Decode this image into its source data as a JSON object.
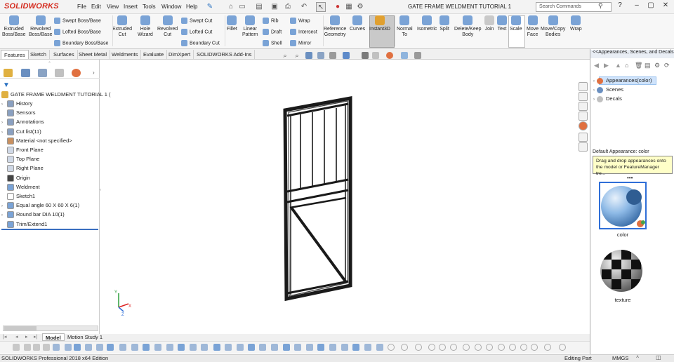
{
  "app": {
    "logo": "SOLIDWORKS",
    "title": "GATE FRAME WELDMENT TUTORIAL 1",
    "menus": [
      "File",
      "Edit",
      "View",
      "Insert",
      "Tools",
      "Window",
      "Help"
    ],
    "search_placeholder": "Search Commands"
  },
  "toolbar": {
    "big_buttons": [
      {
        "label1": "Extruded",
        "label2": "Boss/Base",
        "color": "#7aa3d6",
        "icon": "extrude-boss-icon"
      },
      {
        "label1": "Revolved",
        "label2": "Boss/Base",
        "color": "#7aa3d6",
        "icon": "revolve-boss-icon"
      },
      {
        "label1": "Extruded",
        "label2": "Cut",
        "color": "#7aa3d6",
        "icon": "extrude-cut-icon"
      },
      {
        "label1": "Hole",
        "label2": "Wizard",
        "color": "#7aa3d6",
        "icon": "hole-wizard-icon"
      },
      {
        "label1": "Revolved",
        "label2": "Cut",
        "color": "#7aa3d6",
        "icon": "revolve-cut-icon"
      },
      {
        "label1": "Fillet",
        "label2": "",
        "color": "#7aa3d6",
        "icon": "fillet-icon"
      },
      {
        "label1": "Linear",
        "label2": "Pattern",
        "color": "#7aa3d6",
        "icon": "linear-pattern-icon"
      },
      {
        "label1": "Reference",
        "label2": "Geometry",
        "color": "#7aa3d6",
        "icon": "reference-geometry-icon"
      },
      {
        "label1": "Curves",
        "label2": "",
        "color": "#7aa3d6",
        "icon": "curves-icon"
      },
      {
        "label1": "Instant3D",
        "label2": "",
        "color": "#e0a030",
        "icon": "instant3d-icon"
      },
      {
        "label1": "Normal",
        "label2": "To",
        "color": "#7aa3d6",
        "icon": "normal-to-icon"
      },
      {
        "label1": "Isometric",
        "label2": "",
        "color": "#7aa3d6",
        "icon": "isometric-icon"
      },
      {
        "label1": "Split",
        "label2": "",
        "color": "#7aa3d6",
        "icon": "split-icon"
      },
      {
        "label1": "Delete/Keep",
        "label2": "Body",
        "color": "#7aa3d6",
        "icon": "delete-keep-body-icon"
      },
      {
        "label1": "Join",
        "label2": "",
        "color": "#c9c9c9",
        "icon": "join-icon"
      },
      {
        "label1": "Text",
        "label2": "",
        "color": "#7aa3d6",
        "icon": "text-icon"
      },
      {
        "label1": "Scale",
        "label2": "",
        "color": "#7aa3d6",
        "icon": "scale-icon"
      },
      {
        "label1": "Move",
        "label2": "Face",
        "color": "#7aa3d6",
        "icon": "move-face-icon"
      },
      {
        "label1": "Move/Copy",
        "label2": "Bodies",
        "color": "#7aa3d6",
        "icon": "move-copy-bodies-icon"
      },
      {
        "label1": "Wrap",
        "label2": "",
        "color": "#7aa3d6",
        "icon": "wrap-icon"
      }
    ],
    "small_buttons": [
      {
        "label": "Swept Boss/Base",
        "color": "#7aa3d6"
      },
      {
        "label": "Lofted Boss/Base",
        "color": "#7aa3d6"
      },
      {
        "label": "Boundary Boss/Base",
        "color": "#7aa3d6"
      },
      {
        "label": "Swept Cut",
        "color": "#7aa3d6"
      },
      {
        "label": "Lofted Cut",
        "color": "#7aa3d6"
      },
      {
        "label": "Boundary Cut",
        "color": "#7aa3d6"
      },
      {
        "label": "Rib",
        "color": "#7aa3d6"
      },
      {
        "label": "Draft",
        "color": "#7aa3d6"
      },
      {
        "label": "Shell",
        "color": "#7aa3d6"
      },
      {
        "label": "Wrap",
        "color": "#7aa3d6"
      },
      {
        "label": "Intersect",
        "color": "#7aa3d6"
      },
      {
        "label": "Mirror",
        "color": "#7aa3d6"
      }
    ]
  },
  "tabs": [
    "Features",
    "Sketch",
    "Surfaces",
    "Sheet Metal",
    "Weldments",
    "Evaluate",
    "DimXpert",
    "SOLIDWORKS Add-Ins"
  ],
  "feature_tree": {
    "root": "GATE FRAME WELDMENT TUTORIAL 1  (",
    "items": [
      {
        "label": "History",
        "expand": true,
        "icon": "history-icon",
        "color": "#8aa0c0"
      },
      {
        "label": "Sensors",
        "expand": false,
        "icon": "sensors-icon",
        "color": "#8aa0c0"
      },
      {
        "label": "Annotations",
        "expand": true,
        "icon": "annotations-icon",
        "color": "#8aa0c0"
      },
      {
        "label": "Cut list(11)",
        "expand": true,
        "icon": "cut-list-icon",
        "color": "#8aa0c0"
      },
      {
        "label": "Material <not specified>",
        "expand": false,
        "icon": "material-icon",
        "color": "#c89060"
      },
      {
        "label": "Front Plane",
        "expand": false,
        "icon": "plane-icon",
        "color": "#cfd8e6"
      },
      {
        "label": "Top Plane",
        "expand": false,
        "icon": "plane-icon",
        "color": "#cfd8e6"
      },
      {
        "label": "Right Plane",
        "expand": false,
        "icon": "plane-icon",
        "color": "#cfd8e6"
      },
      {
        "label": "Origin",
        "expand": false,
        "icon": "origin-icon",
        "color": "#444444"
      },
      {
        "label": "Weldment",
        "expand": false,
        "icon": "weldment-icon",
        "color": "#7aa3d6"
      },
      {
        "label": "Sketch1",
        "expand": false,
        "icon": "sketch-icon",
        "color": "#ffffff"
      },
      {
        "label": "Equal angle 60 X 60 X 6(1)",
        "expand": true,
        "icon": "structural-member-icon",
        "color": "#7aa3d6"
      },
      {
        "label": "Round bar DIA 10(1)",
        "expand": true,
        "icon": "structural-member-icon",
        "color": "#7aa3d6"
      },
      {
        "label": "Trim/Extend1",
        "expand": false,
        "icon": "trim-extend-icon",
        "color": "#7aa3d6"
      }
    ]
  },
  "bottom_tabs": [
    "Model",
    "Motion Study 1"
  ],
  "status": {
    "left": "SOLIDWORKS Professional 2018 x64 Edition",
    "mode": "Editing Part",
    "units": "MMGS"
  },
  "right_panel": {
    "title": "<<Appearances, Scenes, and Decals",
    "items": [
      {
        "label": "Appearances(color)",
        "selected": true
      },
      {
        "label": "Scenes",
        "selected": false
      },
      {
        "label": "Decals",
        "selected": false
      }
    ],
    "default_appearance": "Default Appearance: color",
    "tooltip": "Drag and drop appearances onto the model or FeatureManager tre...",
    "thumbnails": [
      {
        "label": "color"
      },
      {
        "label": "texture"
      }
    ]
  },
  "colors": {
    "accent": "#2f6fd8",
    "logo_red": "#d52b1e",
    "model_frame": "#1a1a1a"
  }
}
